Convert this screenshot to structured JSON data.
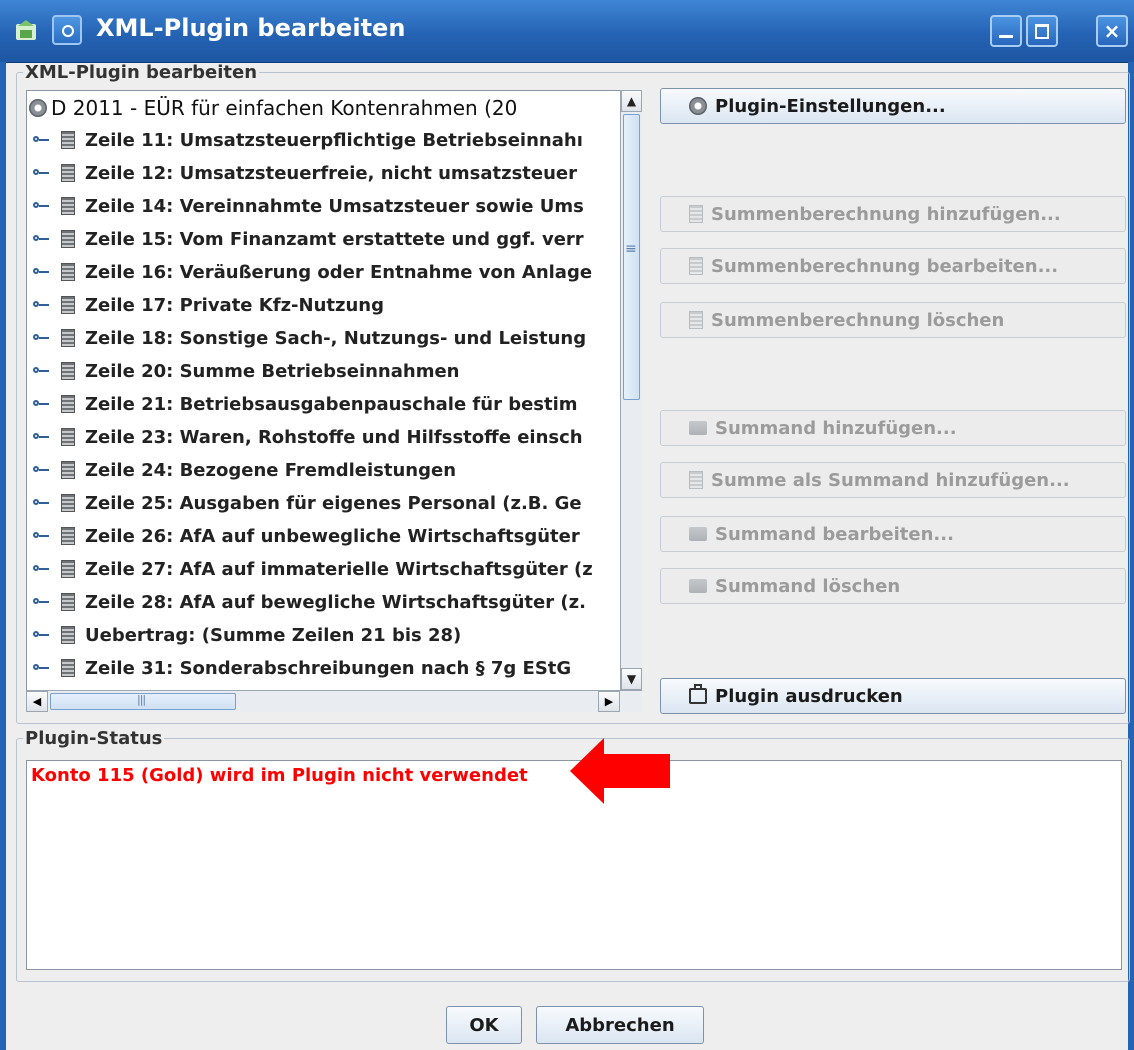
{
  "window": {
    "title": "XML-Plugin bearbeiten",
    "close_glyph": "×"
  },
  "editor_group": {
    "legend": "XML-Plugin bearbeiten"
  },
  "tree": {
    "root_label": "D 2011 - EÜR für einfachen Kontenrahmen (20",
    "rows": [
      "Zeile 11: Umsatzsteuerpflichtige Betriebseinnahı",
      "Zeile 12: Umsatzsteuerfreie, nicht umsatzsteuer",
      "Zeile 14: Vereinnahmte Umsatzsteuer sowie Ums",
      "Zeile 15: Vom Finanzamt erstattete und ggf. verr",
      "Zeile 16: Veräußerung oder Entnahme von Anlage",
      "Zeile 17: Private Kfz-Nutzung",
      "Zeile 18: Sonstige Sach-, Nutzungs- und Leistung",
      "Zeile 20: Summe Betriebseinnahmen",
      "Zeile 21: Betriebsausgabenpauschale für bestim",
      "Zeile 23: Waren, Rohstoffe und Hilfsstoffe einsch",
      "Zeile 24: Bezogene Fremdleistungen",
      "Zeile 25: Ausgaben für eigenes Personal (z.B. Ge",
      "Zeile 26: AfA auf unbewegliche Wirtschaftsgüter",
      "Zeile 27: AfA auf immaterielle Wirtschaftsgüter (z",
      "Zeile 28: AfA auf bewegliche Wirtschaftsgüter (z.",
      "Uebertrag: (Summe Zeilen 21 bis 28)",
      "Zeile 31: Sonderabschreibungen nach § 7g EStG"
    ]
  },
  "buttons": {
    "plugin_settings": "Plugin-Einstellungen...",
    "add_sum_calc": "Summenberechnung hinzufügen...",
    "edit_sum_calc": "Summenberechnung bearbeiten...",
    "delete_sum_calc": "Summenberechnung löschen",
    "add_summand": "Summand hinzufügen...",
    "add_sum_as_summand": "Summe als Summand hinzufügen...",
    "edit_summand": "Summand bearbeiten...",
    "delete_summand": "Summand löschen",
    "print_plugin": "Plugin ausdrucken",
    "ok": "OK",
    "cancel": "Abbrechen"
  },
  "status_group": {
    "legend": "Plugin-Status",
    "message": "Konto 115 (Gold) wird im Plugin nicht verwendet",
    "message_color": "#ff0000"
  },
  "annotation": {
    "arrow_color": "#ff0000"
  }
}
